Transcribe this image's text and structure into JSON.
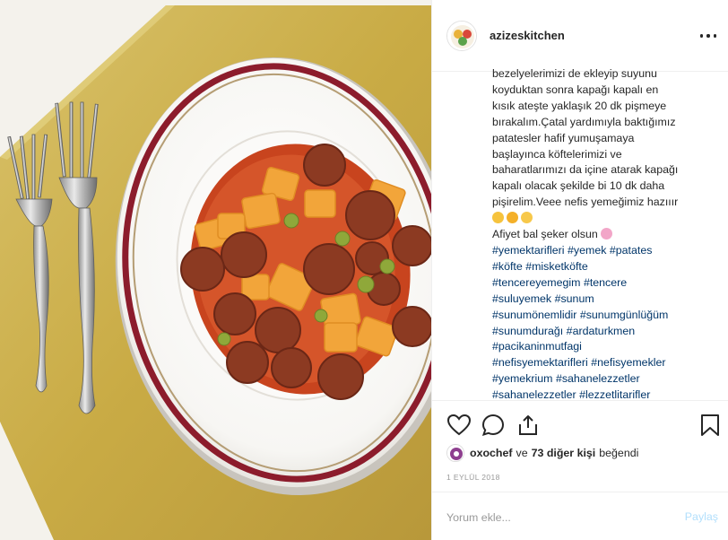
{
  "post": {
    "username": "azizeskitchen",
    "more_icon": "more-horizontal-icon",
    "caption_lines": [
      "bezelyelerimizi de ekleyip suyunu",
      "koyduktan sonra kapağı kapalı en",
      "kısık ateşte yaklaşık 20 dk pişmeye",
      "bırakalım.Çatal yardımıyla baktığımız",
      "patatesler hafif yumuşamaya",
      "başlayınca köftelerimizi ve",
      "baharatlarımızı da içine atarak kapağı",
      "kapalı olacak şekilde bi 10 dk daha",
      "pişirelim.Veee nefis yemeğimiz hazııır"
    ],
    "caption_emojis": [
      "smiling-face-emoji",
      "star-struck-emoji",
      "grinning-face-emoji"
    ],
    "closing_line": "Afiyet bal şeker olsun",
    "closing_emoji": "cherry-blossom-emoji",
    "hashtag_lines": [
      [
        "#yemektarifleri",
        "#yemek",
        "#patates"
      ],
      [
        "#köfte",
        "#misketköfte"
      ],
      [
        "#tencereyemegim",
        "#tencere"
      ],
      [
        "#suluyemek",
        "#sunum"
      ],
      [
        "#sunumönemlidir",
        "#sunumgünlüğüm"
      ],
      [
        "#sunumdurağı",
        "#ardaturkmen"
      ],
      [
        "#pacikaninmutfagi"
      ],
      [
        "#nefisyemektarifleri",
        "#nefisyemekler"
      ],
      [
        "#yemekrium",
        "#sahanelezzetler"
      ],
      [
        "#sahanelezzetler",
        "#lezzetlitarifler"
      ]
    ],
    "likes": {
      "first_liker": "oxochef",
      "connector": "ve",
      "others": "73 diğer kişi",
      "suffix": "beğendi"
    },
    "date": "1 Eylül 2018",
    "comment": {
      "placeholder": "Yorum ekle...",
      "value": "",
      "post_label": "Paylaş"
    }
  },
  "icons": {
    "like": "heart-icon",
    "comment": "comment-icon",
    "share": "share-icon",
    "save": "bookmark-icon"
  },
  "colors": {
    "link": "#003569",
    "text": "#262626",
    "muted": "#999999",
    "post_button_disabled": "#b2dffc",
    "border": "#efefef"
  }
}
